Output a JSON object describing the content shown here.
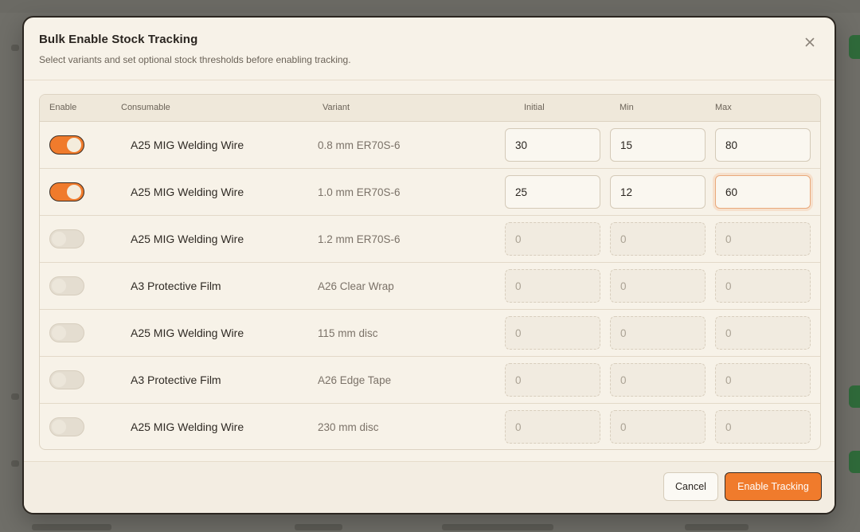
{
  "dialog": {
    "title": "Bulk Enable Stock Tracking",
    "subtitle": "Select variants and set optional stock thresholds before enabling tracking.",
    "close_icon": "close-icon"
  },
  "table": {
    "headers": {
      "enable": "Enable",
      "consumable": "Consumable",
      "variant": "Variant",
      "initial": "Initial",
      "min": "Min",
      "max": "Max"
    },
    "rows": [
      {
        "enabled": true,
        "consumable": "A25 MIG Welding Wire",
        "variant": "0.8 mm ER70S-6",
        "initial": "30",
        "min": "15",
        "max": "80"
      },
      {
        "enabled": true,
        "consumable": "A25 MIG Welding Wire",
        "variant": "1.0 mm ER70S-6",
        "initial": "25",
        "min": "12",
        "max": "60"
      },
      {
        "enabled": false,
        "consumable": "A25 MIG Welding Wire",
        "variant": "1.2 mm ER70S-6",
        "initial": "0",
        "min": "0",
        "max": "0"
      },
      {
        "enabled": false,
        "consumable": "A3 Protective Film",
        "variant": "A26 Clear Wrap",
        "initial": "0",
        "min": "0",
        "max": "0"
      },
      {
        "enabled": false,
        "consumable": "A25 MIG Welding Wire",
        "variant": "115 mm disc",
        "initial": "0",
        "min": "0",
        "max": "0"
      },
      {
        "enabled": false,
        "consumable": "A3 Protective Film",
        "variant": "A26 Edge Tape",
        "initial": "0",
        "min": "0",
        "max": "0"
      },
      {
        "enabled": false,
        "consumable": "A25 MIG Welding Wire",
        "variant": "230 mm disc",
        "initial": "0",
        "min": "0",
        "max": "0"
      }
    ]
  },
  "footer": {
    "cancel_label": "Cancel",
    "confirm_label": "Enable Tracking"
  },
  "colors": {
    "accent": "#f07b2c",
    "surface": "#f7f2e8",
    "overlay": "#6f6e68"
  }
}
